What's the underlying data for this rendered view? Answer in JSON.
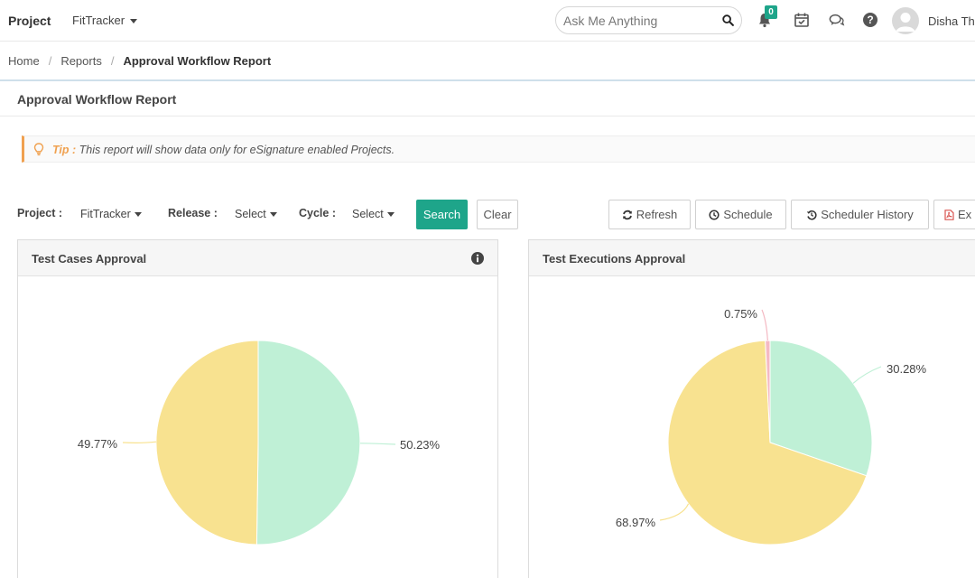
{
  "topbar": {
    "brand": "Project",
    "project_selected": "FitTracker",
    "search_placeholder": "Ask Me Anything",
    "notification_count": "0",
    "user_name": "Disha Th"
  },
  "breadcrumb": {
    "home": "Home",
    "sep1": "/",
    "reports": "Reports",
    "sep2": "/",
    "current": "Approval Workflow Report"
  },
  "page_title": "Approval Workflow Report",
  "tip": {
    "label": "Tip :",
    "text": "This report will show data only for eSignature enabled Projects."
  },
  "filters": {
    "project_label": "Project :",
    "project_value": "FitTracker",
    "release_label": "Release :",
    "release_value": "Select",
    "cycle_label": "Cycle :",
    "cycle_value": "Select",
    "search_button": "Search",
    "clear_button": "Clear"
  },
  "actions": {
    "refresh": "Refresh",
    "schedule": "Schedule",
    "scheduler_history": "Scheduler History",
    "export": "Ex"
  },
  "colors": {
    "accent": "#1ea58a",
    "tip_accent": "#f0a150",
    "slice_green": "#bff0d6",
    "slice_yellow": "#f8e290",
    "slice_pink": "#f4b9c3"
  },
  "chart_data": [
    {
      "type": "pie",
      "title": "Test Cases Approval",
      "slices": [
        {
          "value": 50.23,
          "label": "50.23%",
          "color": "#bff0d6"
        },
        {
          "value": 49.77,
          "label": "49.77%",
          "color": "#f8e290"
        }
      ]
    },
    {
      "type": "pie",
      "title": "Test Executions Approval",
      "slices": [
        {
          "value": 30.28,
          "label": "30.28%",
          "color": "#bff0d6"
        },
        {
          "value": 68.97,
          "label": "68.97%",
          "color": "#f8e290"
        },
        {
          "value": 0.75,
          "label": "0.75%",
          "color": "#f4b9c3"
        }
      ]
    }
  ]
}
